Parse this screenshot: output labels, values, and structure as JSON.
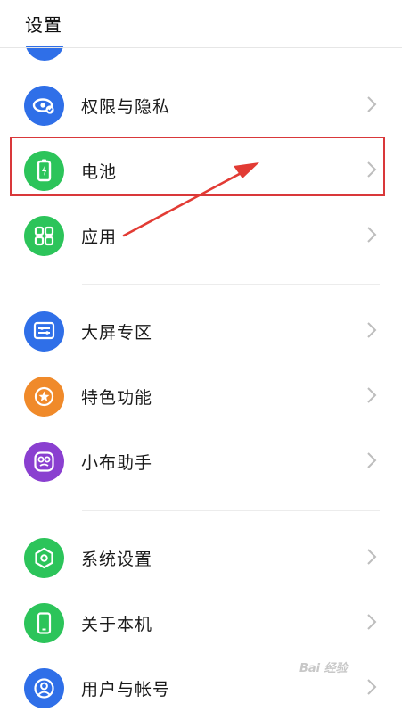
{
  "header": {
    "title": "设置"
  },
  "colors": {
    "blue": "#2f6fe8",
    "green": "#2cc45a",
    "orange": "#f08a2a",
    "purple": "#8a3fd0",
    "highlight": "#d9383a"
  },
  "sections": [
    {
      "items": [
        {
          "label": "权限与隐私",
          "icon": "eye-shield-icon"
        },
        {
          "label": "电池",
          "icon": "battery-icon"
        },
        {
          "label": "应用",
          "icon": "apps-grid-icon"
        }
      ]
    },
    {
      "items": [
        {
          "label": "大屏专区",
          "icon": "large-screen-icon"
        },
        {
          "label": "特色功能",
          "icon": "star-badge-icon"
        },
        {
          "label": "小布助手",
          "icon": "assistant-icon"
        }
      ]
    },
    {
      "items": [
        {
          "label": "系统设置",
          "icon": "hexagon-settings-icon"
        },
        {
          "label": "关于本机",
          "icon": "phone-icon"
        },
        {
          "label": "用户与帐号",
          "icon": "user-icon"
        }
      ]
    }
  ],
  "watermark": "Bai 经验"
}
